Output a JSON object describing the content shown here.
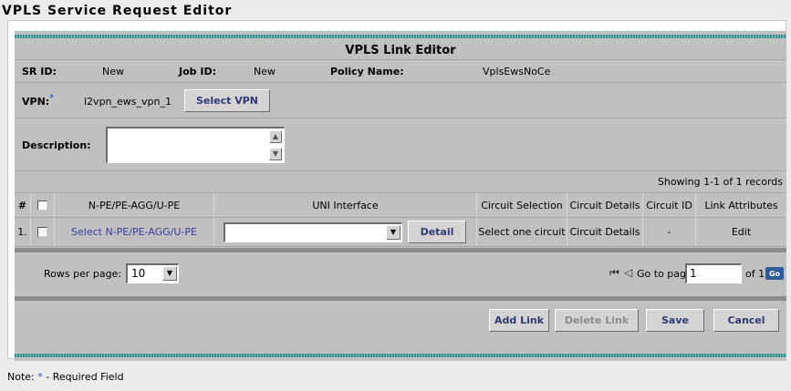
{
  "page": {
    "title": "VPLS Service Request Editor"
  },
  "editor": {
    "title": "VPLS Link Editor"
  },
  "info": {
    "sr_id_label": "SR ID:",
    "sr_id_value": "New",
    "job_id_label": "Job ID:",
    "job_id_value": "New",
    "policy_label": "Policy Name:",
    "policy_value": "VplsEwsNoCe"
  },
  "vpn": {
    "label": "VPN:",
    "required_mark": "*",
    "value": "l2vpn_ews_vpn_1",
    "select_button": "Select VPN"
  },
  "description": {
    "label": "Description:",
    "value": ""
  },
  "table": {
    "showing": "Showing 1-1 of 1 records",
    "columns": [
      "#",
      "",
      "N-PE/PE-AGG/U-PE",
      "UNI Interface",
      "Circuit Selection",
      "Circuit Details",
      "Circuit ID",
      "Link Attributes"
    ],
    "rows": [
      {
        "num": "1.",
        "npe_link": "Select N-PE/PE-AGG/U-PE",
        "uni_value": "",
        "detail_button": "Detail",
        "circuit_selection": "Select one circuit",
        "circuit_details": "Circuit Details",
        "circuit_id": "-",
        "link_attributes": "Edit"
      }
    ]
  },
  "pager": {
    "rows_per_page_label": "Rows per page:",
    "rows_per_page_value": "10",
    "go_to_label": "Go to page:",
    "page_value": "1",
    "of_label": "of 1",
    "go_button": "Go"
  },
  "actions": {
    "add_link": "Add Link",
    "delete_link": "Delete Link",
    "save": "Save",
    "cancel": "Cancel"
  },
  "note": {
    "prefix": "Note:",
    "mark": "*",
    "text": "- Required Field"
  },
  "colors": {
    "accent_teal": "#3d8f8f",
    "link": "#3c3c9c",
    "button_text": "#333a73",
    "go_button": "#2d5c94"
  }
}
